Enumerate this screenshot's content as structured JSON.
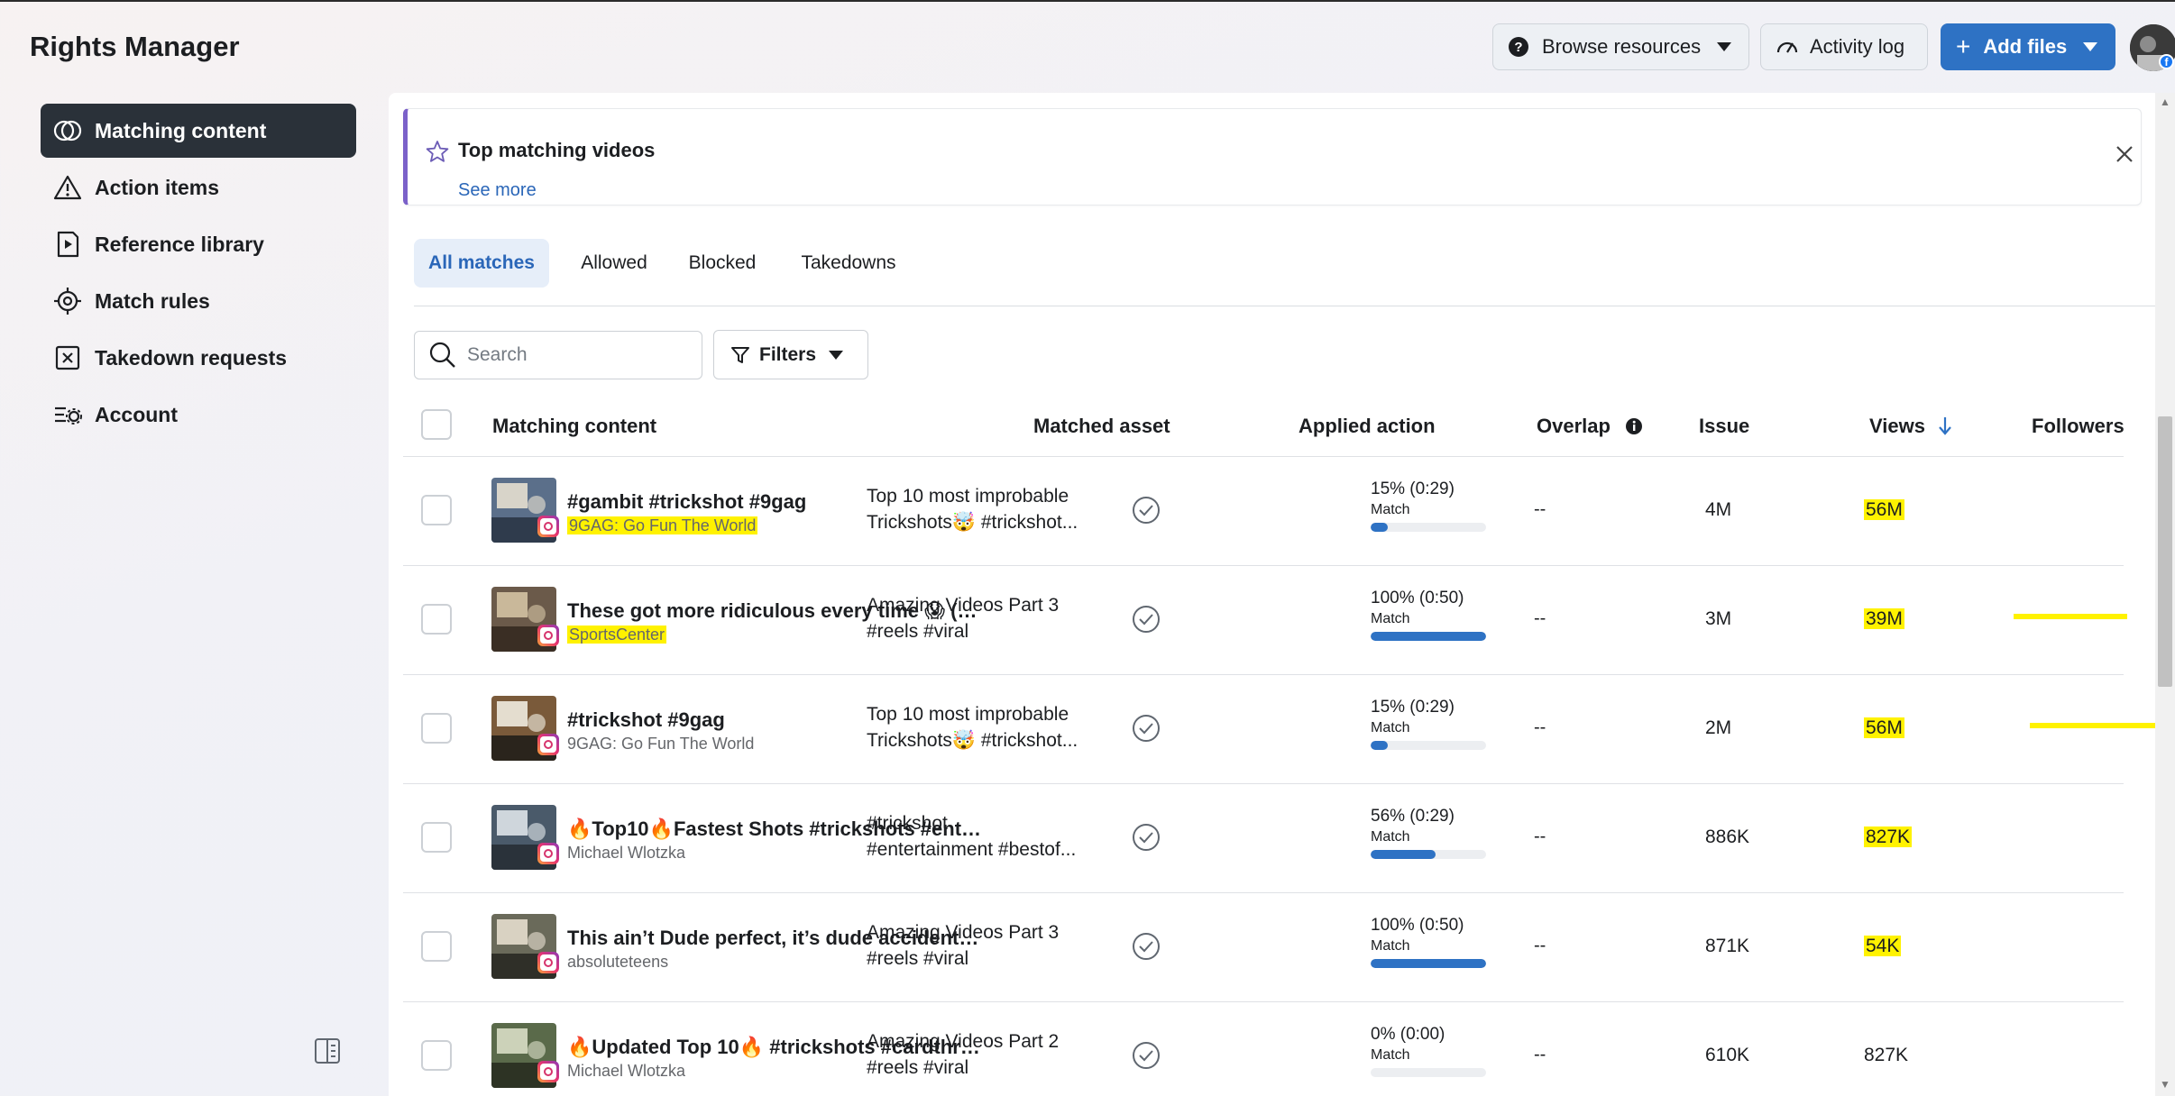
{
  "app": {
    "title": "Rights Manager"
  },
  "header": {
    "browse_resources": "Browse resources",
    "activity_log": "Activity log",
    "add_files": "Add files"
  },
  "sidebar": {
    "items": [
      {
        "label": "Matching content",
        "icon": "matching-icon",
        "active": true
      },
      {
        "label": "Action items",
        "icon": "warning-icon"
      },
      {
        "label": "Reference library",
        "icon": "video-file-icon"
      },
      {
        "label": "Match rules",
        "icon": "crosshair-icon"
      },
      {
        "label": "Takedown requests",
        "icon": "takedown-icon"
      },
      {
        "label": "Account",
        "icon": "settings-list-icon"
      }
    ]
  },
  "banner": {
    "title": "Top matching videos",
    "link": "See more"
  },
  "tabs": [
    "All matches",
    "Allowed",
    "Blocked",
    "Takedowns"
  ],
  "search": {
    "placeholder": "Search"
  },
  "filters": {
    "label": "Filters"
  },
  "table": {
    "headers": {
      "content": "Matching content",
      "asset": "Matched asset",
      "action": "Applied action",
      "overlap": "Overlap",
      "issue": "Issue",
      "views": "Views",
      "followers": "Followers"
    },
    "rows": [
      {
        "title": "#gambit #trickshot #9gag",
        "account": "9GAG: Go Fun The World",
        "asset_line1": "Top 10 most improbable",
        "asset_line2": "Trickshots🤯 #trickshot...",
        "overlap": "15% (0:29)",
        "overlap_label": "Match",
        "overlap_pct": 15,
        "issue": "--",
        "views": "4M",
        "followers": "56M"
      },
      {
        "title": "These got more ridiculous every time 😱 (via...",
        "account": "SportsCenter",
        "asset_line1": "Amazing Videos Part 3",
        "asset_line2": "#reels #viral",
        "overlap": "100% (0:50)",
        "overlap_label": "Match",
        "overlap_pct": 100,
        "issue": "--",
        "views": "3M",
        "followers": "39M"
      },
      {
        "title": "#trickshot #9gag",
        "account": "9GAG: Go Fun The World",
        "asset_line1": "Top 10 most improbable",
        "asset_line2": "Trickshots🤯 #trickshot...",
        "overlap": "15% (0:29)",
        "overlap_label": "Match",
        "overlap_pct": 15,
        "issue": "--",
        "views": "2M",
        "followers": "56M"
      },
      {
        "title": "🔥Top10🔥Fastest Shots #trickshots #entert...",
        "account": "Michael Wlotzka",
        "asset_line1": "#trickshot",
        "asset_line2": "#entertainment #bestof...",
        "overlap": "56% (0:29)",
        "overlap_label": "Match",
        "overlap_pct": 56,
        "issue": "--",
        "views": "886K",
        "followers": "827K"
      },
      {
        "title": "This ain’t Dude perfect, it’s dude accident Fol...",
        "account": "absoluteteens",
        "asset_line1": "Amazing Videos Part 3",
        "asset_line2": "#reels #viral",
        "overlap": "100% (0:50)",
        "overlap_label": "Match",
        "overlap_pct": 100,
        "issue": "--",
        "views": "871K",
        "followers": "54K"
      },
      {
        "title": "🔥Updated Top 10🔥 #trickshots #cardthro...",
        "account": "Michael Wlotzka",
        "asset_line1": "Amazing Videos Part 2",
        "asset_line2": "#reels #viral",
        "overlap": "0% (0:00)",
        "overlap_label": "Match",
        "overlap_pct": 0,
        "issue": "--",
        "views": "610K",
        "followers": "827K"
      }
    ]
  },
  "colors": {
    "accent": "#2e72c4",
    "highlight": "#fff200",
    "sidebar_active": "#2a3139",
    "banner_accent": "#7b61c9"
  }
}
